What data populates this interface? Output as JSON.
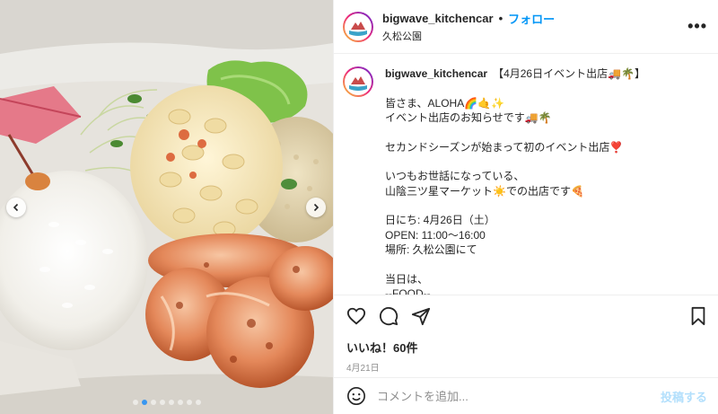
{
  "post": {
    "username": "bigwave_kitchencar",
    "follow_label": "フォロー",
    "separator": "•",
    "location": "久松公園",
    "more_label": "•••",
    "caption_first": "【4月26日イベント出店🚚🌴】",
    "caption_lines": [
      "皆さま、ALOHA🌈🤙✨",
      "イベント出店のお知らせです🚚🌴",
      "",
      "セカンドシーズンが始まって初のイベント出店❣️",
      "",
      "いつもお世話になっている、",
      "山陰三ツ星マーケット☀️での出店です🍕",
      "",
      "日にち: 4月26日（土）",
      "OPEN: 11:00〜16:00",
      "場所: 久松公園にて",
      "",
      "当日は、",
      "--FOOD--"
    ],
    "likes": "いいね！60件",
    "date": "4月21日"
  },
  "comment": {
    "placeholder": "コメントを追加...",
    "post_label": "投稿する"
  },
  "carousel": {
    "total": 8,
    "active_index": 1
  },
  "icons": {
    "like": "heart-icon",
    "comment": "comment-icon",
    "share": "share-icon",
    "save": "bookmark-icon",
    "emoji": "emoji-icon",
    "prev": "chevron-left-icon",
    "next": "chevron-right-icon"
  },
  "colors": {
    "accent": "#0095f6",
    "post_disabled": "#b2dffc",
    "meta": "#8e8e8e"
  }
}
